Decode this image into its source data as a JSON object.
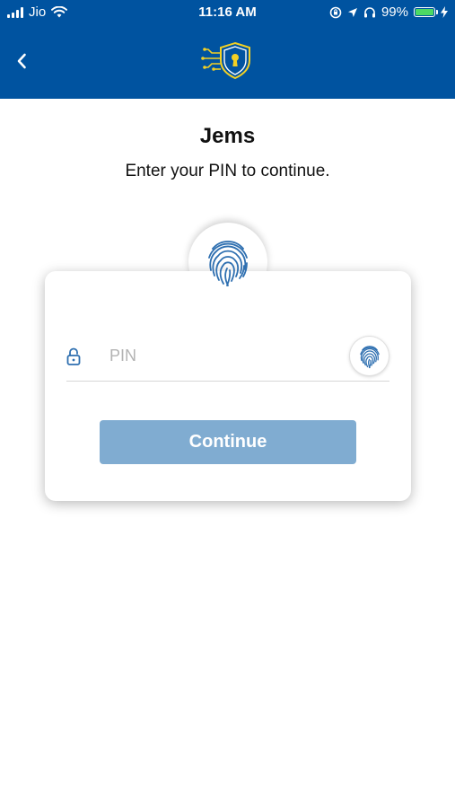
{
  "status_bar": {
    "carrier": "Jio",
    "time": "11:16 AM",
    "battery_percent": "99%",
    "battery_level": 0.99,
    "icons": [
      "signal-icon",
      "wifi-icon",
      "screen-lock-rotation-icon",
      "location-icon",
      "headphones-icon",
      "battery-icon",
      "charging-icon"
    ]
  },
  "header": {
    "back_icon": "chevron-left-icon",
    "logo_icon": "shield-keyhole-circuit-icon",
    "background_color": "#0053a0"
  },
  "main": {
    "title": "Jems",
    "subtitle": "Enter your PIN to continue."
  },
  "card": {
    "badge_icon": "fingerprint-icon",
    "lock_icon": "lock-icon",
    "pin_value": "",
    "pin_placeholder": "PIN",
    "fingerprint_button_icon": "fingerprint-icon",
    "continue_label": "Continue",
    "continue_color": "#80acd1",
    "accent_color": "#2e6fb0"
  }
}
